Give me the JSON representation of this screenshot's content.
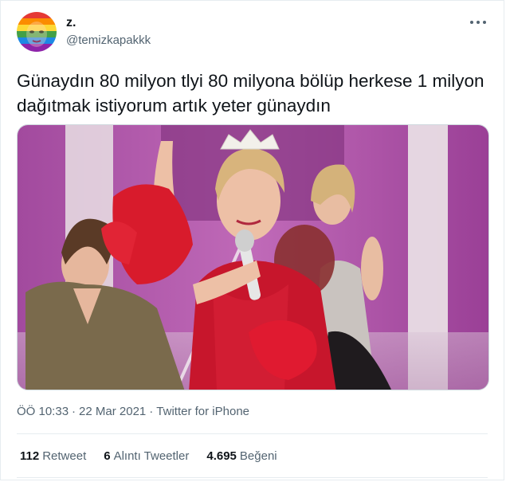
{
  "author": {
    "display_name": "z.",
    "handle": "@temizkapakkk",
    "avatar": "rainbow-face-avatar"
  },
  "tweet": {
    "text": "Günaydın 80 milyon tlyi 80 milyona bölüp herkese 1 milyon dağıtmak istiyorum artık yeter günaydın"
  },
  "media": {
    "description_icon": "photo"
  },
  "meta": {
    "time": "ÖÖ 10:33",
    "separator": "·",
    "date": "22 Mar 2021",
    "source": "Twitter for iPhone"
  },
  "stats": {
    "retweets": {
      "count": "112",
      "label": "Retweet"
    },
    "quotes": {
      "count": "6",
      "label": "Alıntı Tweetler"
    },
    "likes": {
      "count": "4.695",
      "label": "Beğeni"
    }
  },
  "colors": {
    "text": "#0f1419",
    "secondary": "#536471",
    "divider": "#e6ecf0"
  }
}
